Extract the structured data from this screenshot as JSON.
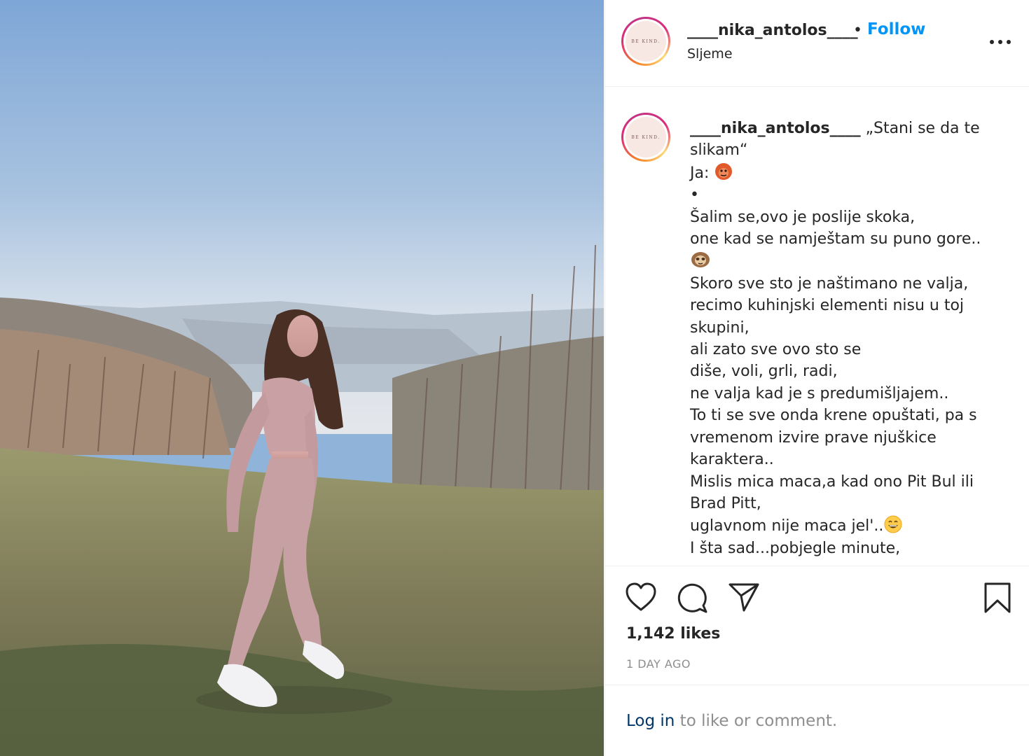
{
  "post": {
    "username": "____nika_antolos____",
    "follow_separator": "•",
    "follow_label": "Follow",
    "location": "Sljeme",
    "avatar_text": "BE KIND.",
    "caption_lines": [
      "„Stani se da te",
      "slikam“",
      "Ja:",
      "•",
      "Šalim se,ovo je poslije skoka,",
      "one kad se namještam su puno gore..",
      "",
      "Skoro sve sto je naštimano ne valja,",
      "recimo kuhinjski elementi nisu u toj",
      "skupini,",
      "ali zato sve ovo sto se",
      "diše, voli, grli, radi,",
      "ne valja kad je s predumišljajem..",
      "To ti se sve onda krene opuštati, pa s",
      "vremenom izvire prave njuškice",
      "karaktera..",
      "Mislis mica maca,a kad ono Pit Bul ili",
      "Brad Pitt,",
      "uglavnom nije maca jel'..",
      "I šta sad...pobjegle minute,"
    ],
    "emojis": [
      "gorilla-emoji",
      "sloth-emoji",
      "grinning-emoji"
    ],
    "likes": "1,142 likes",
    "timestamp": "1 DAY AGO",
    "login_link": "Log in",
    "login_rest": " to like or comment."
  },
  "icons": [
    "more-options-icon",
    "heart-icon",
    "comment-icon",
    "share-icon",
    "bookmark-icon"
  ],
  "colors": {
    "follow_blue": "#0095f6",
    "login_link": "#00376b",
    "muted_gray": "#8e8e8e",
    "text": "#262626",
    "divider": "#efefef"
  }
}
